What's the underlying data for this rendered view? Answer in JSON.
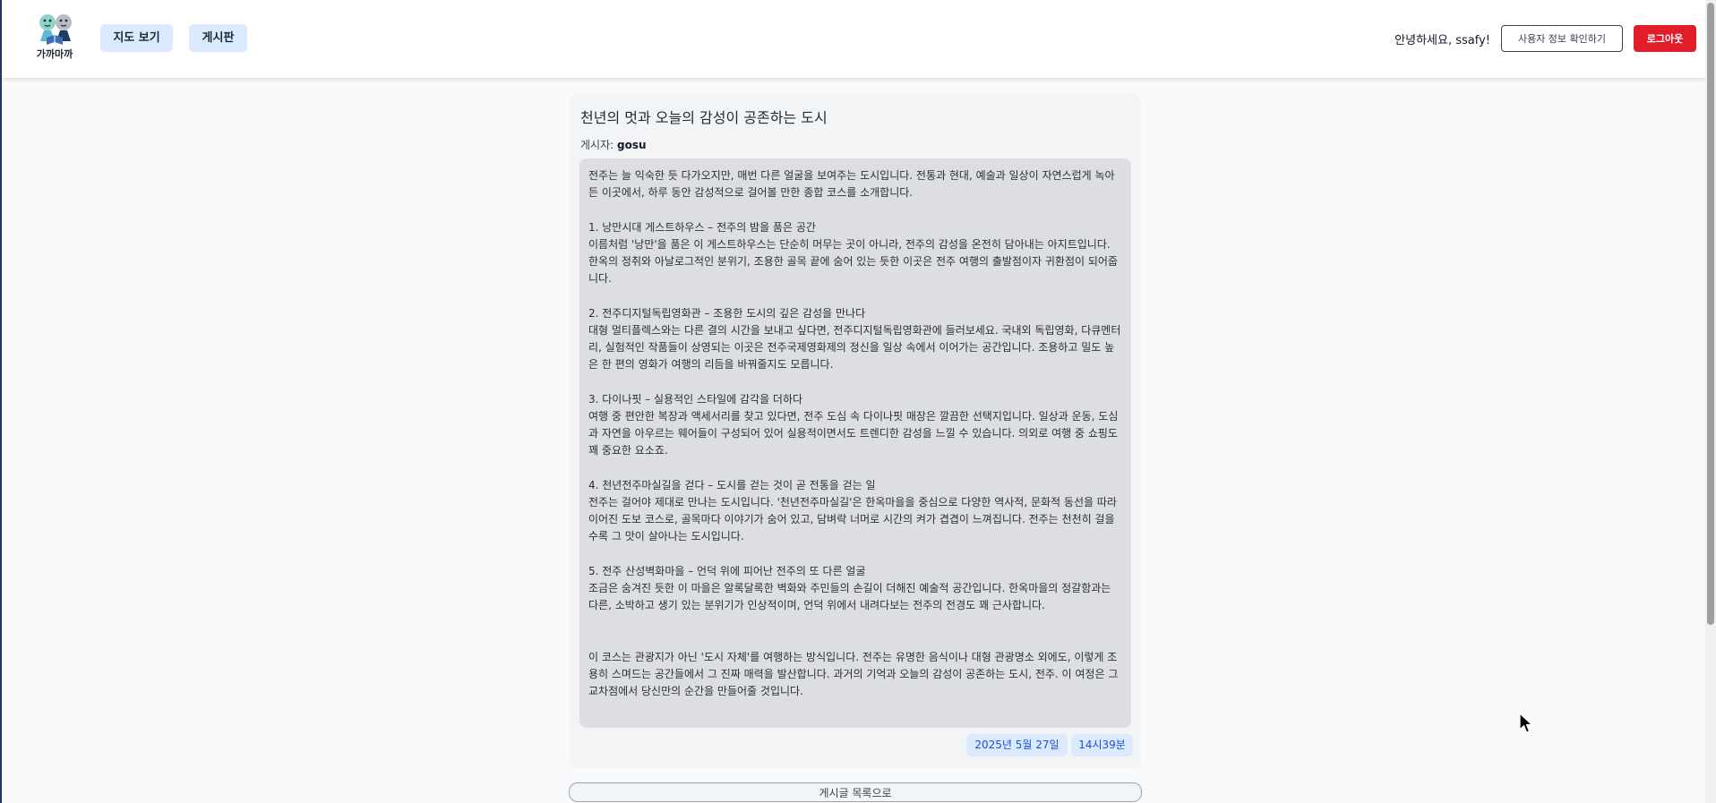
{
  "header": {
    "logo_text": "가까마까",
    "nav": {
      "map_label": "지도 보기",
      "board_label": "게시판"
    },
    "greeting": "안녕하세요, ssafy!",
    "userinfo_label": "사용자 정보 확인하기",
    "logout_label": "로그아웃"
  },
  "post": {
    "title": "천년의 멋과 오늘의 감성이 공존하는 도시",
    "author_prefix": "게시자: ",
    "author": "gosu",
    "body": "전주는 늘 익숙한 듯 다가오지만, 매번 다른 얼굴을 보여주는 도시입니다. 전통과 현대, 예술과 일상이 자연스럽게 녹아든 이곳에서, 하루 동안 감성적으로 걸어볼 만한 종합 코스를 소개합니다.\n\n1. 낭만시대 게스트하우스 – 전주의 밤을 품은 공간\n이름처럼 '낭만'을 품은 이 게스트하우스는 단순히 머무는 곳이 아니라, 전주의 감성을 온전히 담아내는 아지트입니다. 한옥의 정취와 아날로그적인 분위기, 조용한 골목 끝에 숨어 있는 듯한 이곳은 전주 여행의 출발점이자 귀환점이 되어줍니다.\n\n2. 전주디지털독립영화관 – 조용한 도시의 깊은 감성을 만나다\n대형 멀티플렉스와는 다른 결의 시간을 보내고 싶다면, 전주디지털독립영화관에 들러보세요. 국내외 독립영화, 다큐멘터리, 실험적인 작품들이 상영되는 이곳은 전주국제영화제의 정신을 일상 속에서 이어가는 공간입니다. 조용하고 밀도 높은 한 편의 영화가 여행의 리듬을 바꿔줄지도 모릅니다.\n\n3. 다이나핏 – 실용적인 스타일에 감각을 더하다\n여행 중 편안한 복장과 액세서리를 찾고 있다면, 전주 도심 속 다이나핏 매장은 깔끔한 선택지입니다. 일상과 운동, 도심과 자연을 아우르는 웨어들이 구성되어 있어 실용적이면서도 트렌디한 감성을 느낄 수 있습니다. 의외로 여행 중 쇼핑도 꽤 중요한 요소죠.\n\n4. 천년전주마실길을 걷다 – 도시를 걷는 것이 곧 전통을 걷는 일\n전주는 걸어야 제대로 만나는 도시입니다. '천년전주마실길'은 한옥마을을 중심으로 다양한 역사적, 문화적 동선을 따라 이어진 도보 코스로, 골목마다 이야기가 숨어 있고, 담벼락 너머로 시간의 켜가 겹겹이 느껴집니다. 전주는 천천히 걸을수록 그 맛이 살아나는 도시입니다.\n\n5. 전주 산성벽화마을 – 언덕 위에 피어난 전주의 또 다른 얼굴\n조금은 숨겨진 듯한 이 마을은 알록달록한 벽화와 주민들의 손길이 더해진 예술적 공간입니다. 한옥마을의 정갈함과는 다른, 소박하고 생기 있는 분위기가 인상적이며, 언덕 위에서 내려다보는 전주의 전경도 꽤 근사합니다.\n\n\n이 코스는 관광지가 아닌 '도시 자체'를 여행하는 방식입니다. 전주는 유명한 음식이나 대형 관광명소 외에도, 이렇게 조용히 스며드는 공간들에서 그 진짜 매력을 발산합니다. 과거의 기억과 오늘의 감성이 공존하는 도시, 전주. 이 여정은 그 교차점에서 당신만의 순간을 만들어줄 것입니다.",
    "date": "2025년 5월 27일",
    "time": "14시39분"
  },
  "footer": {
    "list_button_label": "게시글 목록으로"
  },
  "colors": {
    "nav_button_bg": "#dbeafe",
    "logout_bg": "#e11d2a",
    "badge_text": "#1d4ed8",
    "card_bg": "#f3f4f6",
    "body_bg": "#dcdee3"
  },
  "icons": {
    "logo": "mascot-logo-icon",
    "cursor": "mouse-cursor-icon"
  }
}
